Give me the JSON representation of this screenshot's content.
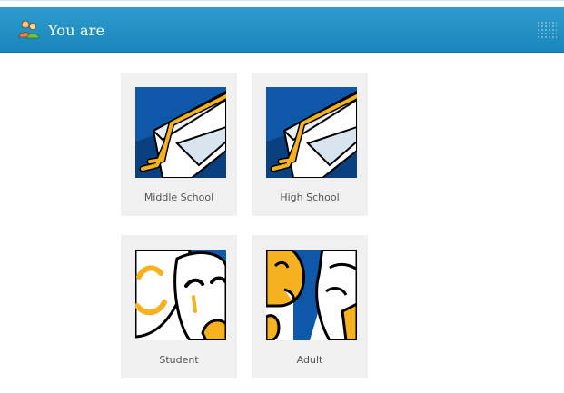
{
  "header": {
    "title": "You are",
    "icon": "users-icon",
    "bg_color": "#2393c7"
  },
  "options": [
    {
      "label": "Middle School",
      "icon": "graduation-cap-icon"
    },
    {
      "label": "High School",
      "icon": "graduation-cap-icon"
    },
    {
      "label": "Student",
      "icon": "theater-masks-icon"
    },
    {
      "label": "Adult",
      "icon": "theater-masks-icon"
    }
  ],
  "colors": {
    "art_blue": "#0f57a8",
    "art_gold": "#f5b120",
    "card_bg": "#f0f0f0"
  }
}
